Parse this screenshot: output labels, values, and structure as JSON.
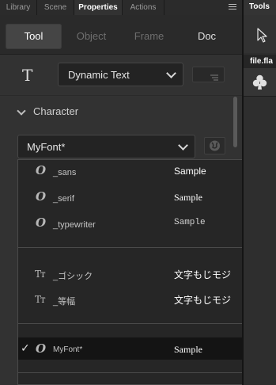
{
  "tabs": [
    {
      "label": "Library",
      "active": false
    },
    {
      "label": "Scene",
      "active": false
    },
    {
      "label": "Properties",
      "active": true
    },
    {
      "label": "Actions",
      "active": false
    }
  ],
  "modes": [
    {
      "label": "Tool",
      "active": true
    },
    {
      "label": "Object",
      "active": false
    },
    {
      "label": "Frame",
      "active": false
    },
    {
      "label": "Doc",
      "active": false
    }
  ],
  "tool": {
    "icon": "T",
    "text_type": "Dynamic Text"
  },
  "character": {
    "section_title": "Character",
    "font_value": "MyFont*"
  },
  "font_list": {
    "groups": [
      [
        {
          "name": "_sans",
          "sample": "Sample",
          "icon": "O",
          "selected": false
        },
        {
          "name": "_serif",
          "sample": "Sample",
          "icon": "O",
          "selected": false
        },
        {
          "name": "_typewriter",
          "sample": "Sample",
          "icon": "O",
          "selected": false
        }
      ],
      [
        {
          "name": "_ゴシック",
          "sample": "文字もじモジ",
          "icon": "Tт",
          "selected": false
        },
        {
          "name": "_等幅",
          "sample": "文字もじモジ",
          "icon": "Tт",
          "selected": false
        }
      ],
      [
        {
          "name": "MyFont*",
          "sample": "Sample",
          "icon": "O",
          "selected": true
        }
      ]
    ],
    "check_mark": "✓"
  },
  "right_dock": {
    "tools_tab": "Tools",
    "file_tab": "file.fla",
    "tool_icon": "selection-arrow-icon",
    "library_icon": "club-icon"
  },
  "colors": {
    "panel_bg": "#323232",
    "dropdown_bg": "#262626",
    "selected_row_bg": "#141414",
    "active_tab_text": "#ffffff"
  }
}
